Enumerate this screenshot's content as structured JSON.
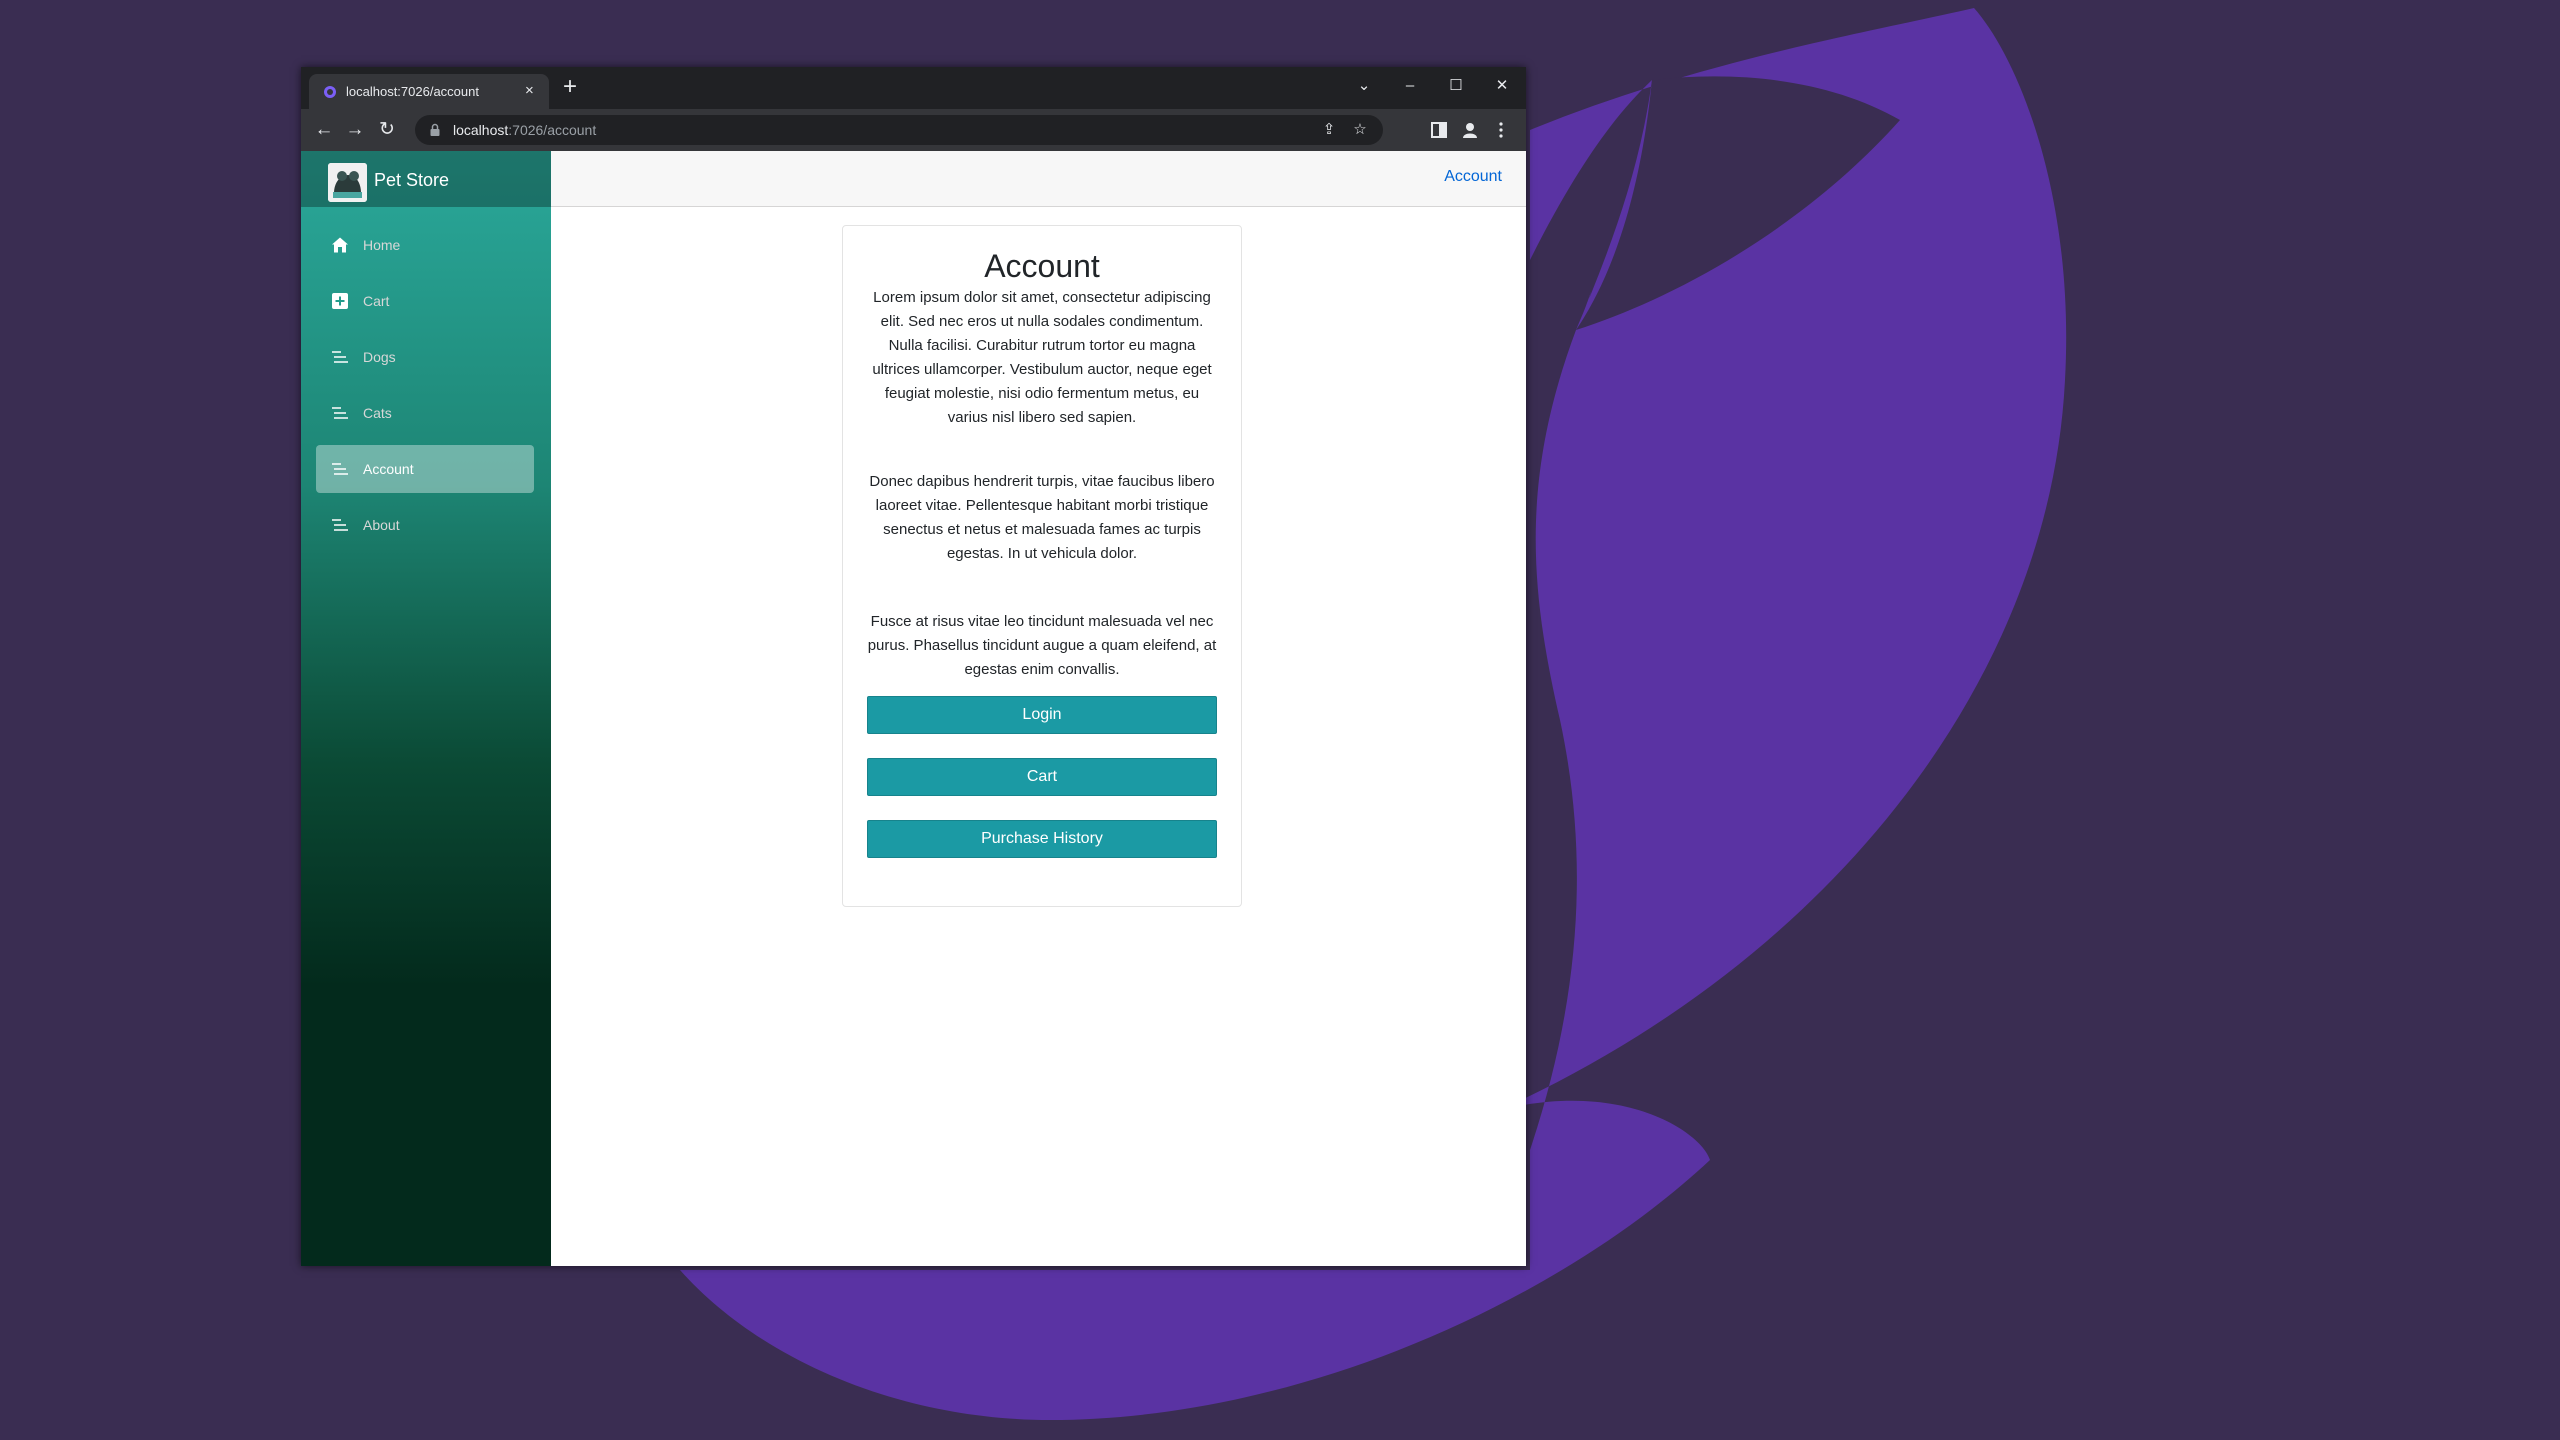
{
  "browser": {
    "tab_title": "localhost:7026/account",
    "tab_close": "×",
    "new_tab": "+",
    "url_host": "localhost",
    "url_path": ":7026/account",
    "controls": {
      "tab_search": "⌄",
      "minimize": "–",
      "maximize": "☐",
      "close": "✕"
    },
    "nav": {
      "back": "←",
      "forward": "→",
      "reload": "↻"
    },
    "icons": [
      "share-icon",
      "star-icon",
      "side-panel-icon",
      "profile-icon",
      "menu-icon"
    ]
  },
  "app": {
    "brand": "Pet Store",
    "sidebar": {
      "items": [
        {
          "label": "Home",
          "icon": "home-icon",
          "active": false
        },
        {
          "label": "Cart",
          "icon": "plus-square-icon",
          "active": false
        },
        {
          "label": "Dogs",
          "icon": "list-icon",
          "active": false
        },
        {
          "label": "Cats",
          "icon": "list-icon",
          "active": false
        },
        {
          "label": "Account",
          "icon": "list-icon",
          "active": true
        },
        {
          "label": "About",
          "icon": "list-icon",
          "active": false
        }
      ]
    },
    "topbar": {
      "link": "Account"
    },
    "card": {
      "title": "Account",
      "paragraphs": [
        "Lorem ipsum dolor sit amet, consectetur adipiscing elit. Sed nec eros ut nulla sodales condimentum. Nulla facilisi. Curabitur rutrum tortor eu magna ultrices ullamcorper. Vestibulum auctor, neque eget feugiat molestie, nisi odio fermentum metus, eu varius nisl libero sed sapien.",
        "Donec dapibus hendrerit turpis, vitae faucibus libero laoreet vitae. Pellentesque habitant morbi tristique senectus et netus et malesuada fames ac turpis egestas. In ut vehicula dolor.",
        "Fusce at risus vitae leo tincidunt malesuada vel nec purus. Phasellus tincidunt augue a quam eleifend, at egestas enim convallis."
      ],
      "buttons": [
        "Login",
        "Cart",
        "Purchase History"
      ]
    }
  },
  "colors": {
    "desktop": "#3a2d52",
    "wallpaper_accent": "#5a33a3",
    "button": "#1b9aa4",
    "link": "#0366d6",
    "sidebar_top": "#2aa89a",
    "sidebar_bottom": "#032a1c"
  }
}
